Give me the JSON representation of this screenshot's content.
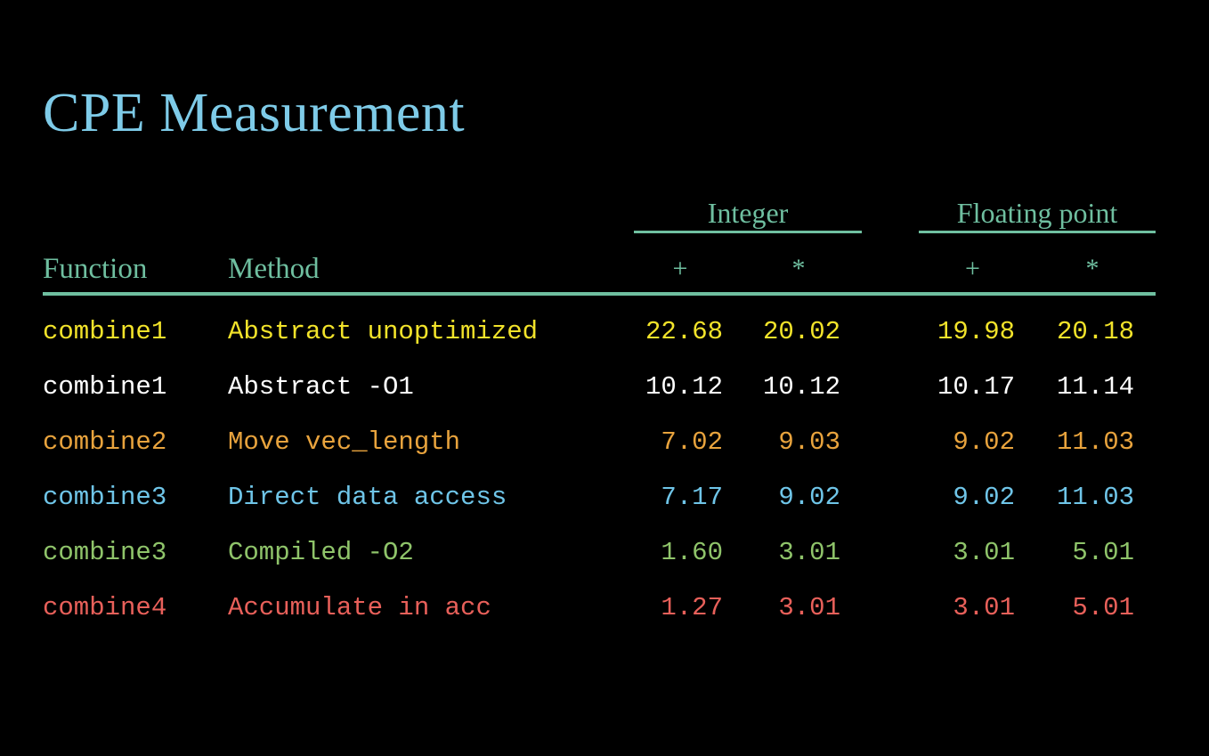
{
  "title": "CPE Measurement",
  "colors": {
    "background": "#000000",
    "title": "#7ecbe8",
    "header": "#6fbfa0",
    "rule": "#6fbfa0",
    "row_yellow": "#f2e32a",
    "row_white": "#ffffff",
    "row_orange": "#e8a33d",
    "row_blue": "#6fc5e8",
    "row_green": "#8fc46a",
    "row_red": "#e8605a"
  },
  "table": {
    "group_headers": [
      {
        "label": "Integer"
      },
      {
        "label": "Floating point"
      }
    ],
    "column_headers": {
      "function": "Function",
      "method": "Method",
      "operators": [
        "+",
        "*",
        "+",
        "*"
      ]
    },
    "rows": [
      {
        "function": "combine1",
        "method": "Abstract unoptimized",
        "values": [
          "22.68",
          "20.02",
          "19.98",
          "20.18"
        ],
        "color": "#f2e32a"
      },
      {
        "function": "combine1",
        "method": "Abstract -O1",
        "values": [
          "10.12",
          "10.12",
          "10.17",
          "11.14"
        ],
        "color": "#ffffff"
      },
      {
        "function": "combine2",
        "method": "Move vec_length",
        "values": [
          "7.02",
          "9.03",
          "9.02",
          "11.03"
        ],
        "color": "#e8a33d"
      },
      {
        "function": "combine3",
        "method": "Direct data access",
        "values": [
          "7.17",
          "9.02",
          "9.02",
          "11.03"
        ],
        "color": "#6fc5e8"
      },
      {
        "function": "combine3",
        "method": "Compiled -O2",
        "values": [
          "1.60",
          "3.01",
          "3.01",
          "5.01"
        ],
        "color": "#8fc46a"
      },
      {
        "function": "combine4",
        "method": "Accumulate in acc",
        "values": [
          "1.27",
          "3.01",
          "3.01",
          "5.01"
        ],
        "color": "#e8605a"
      }
    ]
  },
  "chart_data": {
    "type": "table",
    "title": "CPE Measurement",
    "columns": [
      "Function",
      "Method",
      "Integer +",
      "Integer *",
      "Floating point +",
      "Floating point *"
    ],
    "rows": [
      [
        "combine1",
        "Abstract unoptimized",
        22.68,
        20.02,
        19.98,
        20.18
      ],
      [
        "combine1",
        "Abstract -O1",
        10.12,
        10.12,
        10.17,
        11.14
      ],
      [
        "combine2",
        "Move vec_length",
        7.02,
        9.03,
        9.02,
        11.03
      ],
      [
        "combine3",
        "Direct data access",
        7.17,
        9.02,
        9.02,
        11.03
      ],
      [
        "combine3",
        "Compiled -O2",
        1.6,
        3.01,
        3.01,
        5.01
      ],
      [
        "combine4",
        "Accumulate in acc",
        1.27,
        3.01,
        3.01,
        5.01
      ]
    ]
  }
}
